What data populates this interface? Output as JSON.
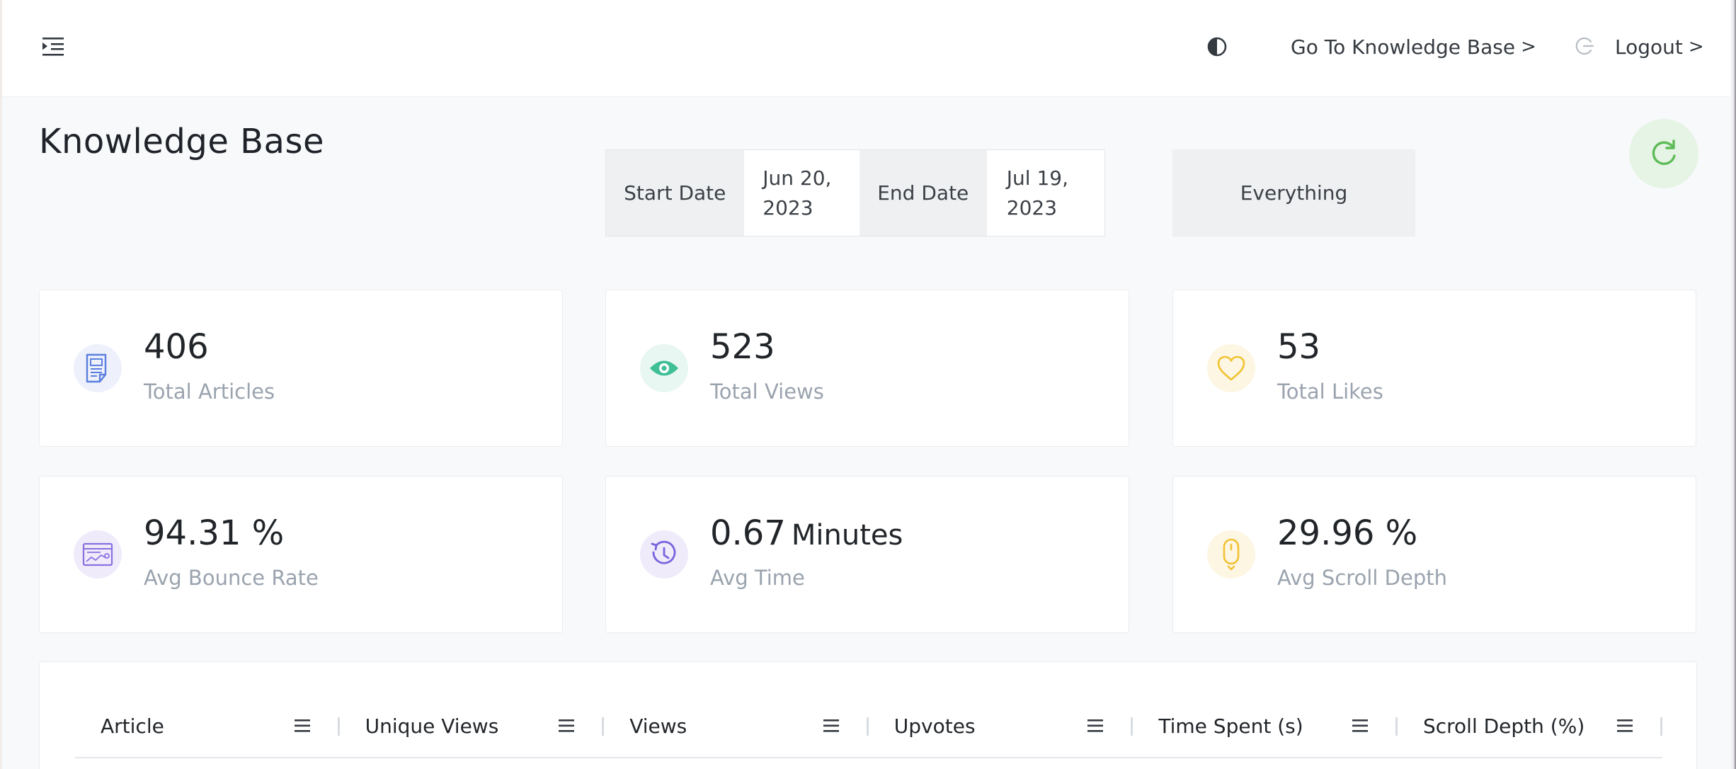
{
  "header": {
    "kb_link_label": "Go To Knowledge Base",
    "logout_label": "Logout",
    "chevron": ">"
  },
  "page": {
    "title": "Knowledge Base"
  },
  "filters": {
    "start_label": "Start Date",
    "start_value": "Jun 20, 2023",
    "end_label": "End Date",
    "end_value": "Jul 19, 2023",
    "scope": "Everything"
  },
  "stats": [
    {
      "value": "406",
      "unit": "",
      "label": "Total Articles",
      "icon": "article-icon",
      "color": "#5b7fe0",
      "bg": "#eef1fb"
    },
    {
      "value": "523",
      "unit": "",
      "label": "Total Views",
      "icon": "eye-icon",
      "color": "#3fbf96",
      "bg": "#e8f7f1"
    },
    {
      "value": "53",
      "unit": "",
      "label": "Total Likes",
      "icon": "heart-icon",
      "color": "#f2c233",
      "bg": "#fdf6e2"
    },
    {
      "value": "94.31 %",
      "unit": "",
      "label": "Avg Bounce Rate",
      "icon": "bounce-chart-icon",
      "color": "#8b70e0",
      "bg": "#efebfb"
    },
    {
      "value": "0.67",
      "unit": "Minutes",
      "label": "Avg Time",
      "icon": "clock-icon",
      "color": "#7b63dc",
      "bg": "#efebfb"
    },
    {
      "value": "29.96 %",
      "unit": "",
      "label": "Avg Scroll Depth",
      "icon": "mouse-icon",
      "color": "#f2c233",
      "bg": "#fdf6e2"
    }
  ],
  "table": {
    "columns": [
      "Article",
      "Unique Views",
      "Views",
      "Upvotes",
      "Time Spent (s)",
      "Scroll Depth (%)"
    ]
  },
  "colors": {
    "accent_green": "#5dbb57",
    "page_bg": "#f8f9fb"
  }
}
